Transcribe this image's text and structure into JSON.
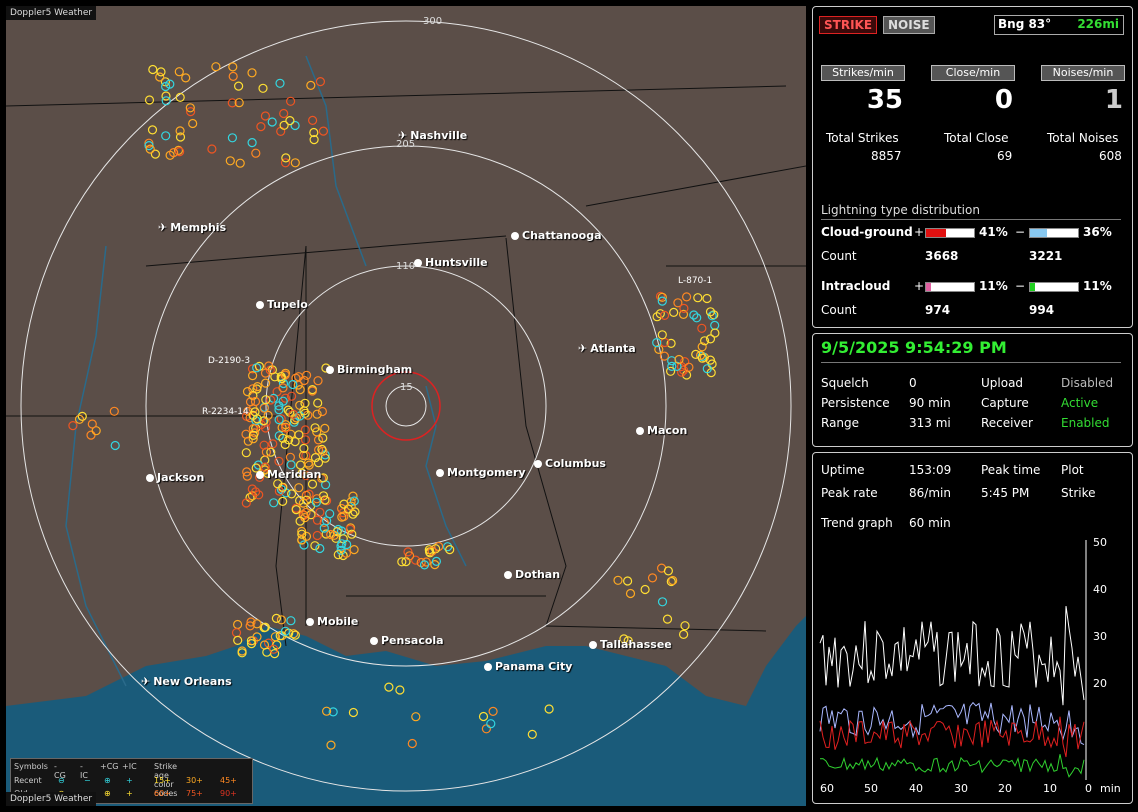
{
  "map": {
    "tag": "Doppler5 Weather",
    "footer_tag": "Doppler5 Weather",
    "range_labels": [
      "300",
      "205",
      "110",
      "15"
    ],
    "cities": [
      {
        "name": "Nashville",
        "icon": "airport-icon"
      },
      {
        "name": "Memphis",
        "icon": "airport-icon"
      },
      {
        "name": "Chattanooga",
        "icon": "city-dot"
      },
      {
        "name": "Huntsville",
        "icon": "city-dot"
      },
      {
        "name": "Tupelo",
        "icon": "city-dot"
      },
      {
        "name": "Birmingham",
        "icon": "city-dot"
      },
      {
        "name": "Atlanta",
        "icon": "airport-icon"
      },
      {
        "name": "Macon",
        "icon": "city-dot"
      },
      {
        "name": "Jackson",
        "icon": "city-dot"
      },
      {
        "name": "Meridian",
        "icon": "city-dot"
      },
      {
        "name": "Montgomery",
        "icon": "city-dot"
      },
      {
        "name": "Columbus",
        "icon": "city-dot"
      },
      {
        "name": "Dothan",
        "icon": "city-dot"
      },
      {
        "name": "Mobile",
        "icon": "city-dot"
      },
      {
        "name": "Pensacola",
        "icon": "city-dot"
      },
      {
        "name": "Tallahassee",
        "icon": "city-dot"
      },
      {
        "name": "Panama City",
        "icon": "city-dot"
      },
      {
        "name": "New Orleans",
        "icon": "airport-icon"
      }
    ],
    "storm_labels": [
      "D-2190-3",
      "R-2234-14",
      "L-870-1"
    ]
  },
  "legend": {
    "header": [
      "Symbols",
      "-CG",
      "-IC",
      "+CG",
      "+IC",
      "Strike age color codes"
    ],
    "recent_label": "Recent",
    "old_label": "Old",
    "recent_ages": [
      "15+",
      "30+",
      "45+"
    ],
    "old_ages": [
      "60+",
      "75+",
      "90+"
    ],
    "colors": {
      "recent_sym": "#33d6e0",
      "old_sym": "#ffe033",
      "a15": "#ffdd33",
      "a30": "#ffaa22",
      "a45": "#ff8822",
      "a60": "#ff7722",
      "a75": "#ee5522",
      "a90": "#dd3322"
    }
  },
  "top": {
    "strike_label": "STRIKE",
    "noise_label": "NOISE",
    "bearing": "Bng 83°",
    "distance": "226mi",
    "headers": [
      "Strikes/min",
      "Close/min",
      "Noises/min"
    ],
    "rates": [
      "35",
      "0",
      "1"
    ],
    "total_labels": [
      "Total Strikes",
      "Total Close",
      "Total Noises"
    ],
    "totals": [
      "8857",
      "69",
      "608"
    ],
    "dist_title": "Lightning type distribution",
    "cg_label": "Cloud-ground",
    "ic_label": "Intracloud",
    "count_label": "Count",
    "plus": "+",
    "minus": "−",
    "cg_pos_pct": "41%",
    "cg_neg_pct": "36%",
    "cg_pos_count": "3668",
    "cg_neg_count": "3221",
    "ic_pos_pct": "11%",
    "ic_neg_pct": "11%",
    "ic_pos_count": "974",
    "ic_neg_count": "994",
    "bar_fill": {
      "cg_pos": 0.41,
      "cg_neg": 0.36,
      "ic_pos": 0.11,
      "ic_neg": 0.11
    },
    "bar_colors": {
      "cg_pos": "#e01010",
      "cg_neg": "#88c8f0",
      "ic_pos": "#e060a0",
      "ic_neg": "#20d020"
    }
  },
  "status": {
    "datetime": "9/5/2025 9:54:29 PM",
    "rows": [
      {
        "k1": "Squelch",
        "v1": "0",
        "k2": "Upload",
        "v2": "Disabled",
        "v2color": "#bbbbbb"
      },
      {
        "k1": "Persistence",
        "v1": "90 min",
        "k2": "Capture",
        "v2": "Active",
        "v2color": "#33dd33"
      },
      {
        "k1": "Range",
        "v1": "313 mi",
        "k2": "Receiver",
        "v2": "Enabled",
        "v2color": "#33dd33"
      }
    ]
  },
  "trend": {
    "uptime_label": "Uptime",
    "uptime": "153:09",
    "peak_time_label": "Peak time",
    "plot_label": "Plot",
    "peak_rate_label": "Peak rate",
    "peak_rate": "86/min",
    "peak_time": "5:45 PM",
    "plot": "Strike",
    "trend_label": "Trend graph",
    "trend_window": "60 min",
    "y_ticks": [
      "50",
      "40",
      "30",
      "20"
    ],
    "x_ticks": [
      "60",
      "50",
      "40",
      "30",
      "20",
      "10",
      "0",
      "min"
    ]
  }
}
